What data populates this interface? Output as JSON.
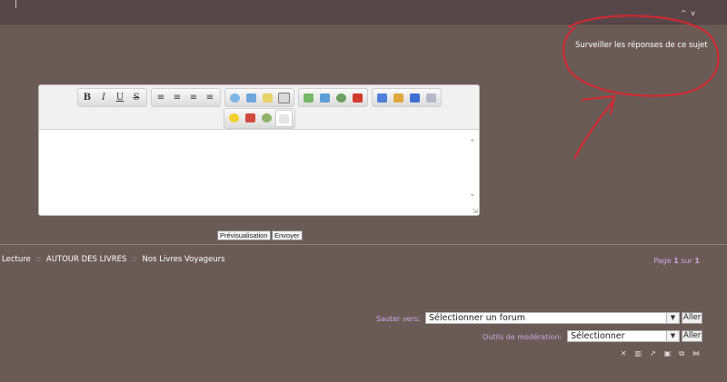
{
  "header": {
    "toggle": "^ v"
  },
  "watch_topic": "Surveiller les réponses de ce sujet",
  "colors": {
    "annotation": "#d8262e",
    "link_accent": "#c8a9e3",
    "background": "#6b5b56"
  },
  "toolbar": {
    "row1": [
      {
        "name": "bold-button",
        "label": "B"
      },
      {
        "name": "italic-button",
        "label": "I"
      },
      {
        "name": "underline-button",
        "label": "U"
      },
      {
        "name": "strikethrough-button",
        "label": "S"
      },
      {
        "name": "align-left-button",
        "label": "≡"
      },
      {
        "name": "align-center-button",
        "label": "≡"
      },
      {
        "name": "align-right-button",
        "label": "≡"
      },
      {
        "name": "justify-button",
        "label": "≡"
      }
    ],
    "icon_buttons": [
      "quote-icon",
      "code-icon",
      "spoiler-icon",
      "hide-icon",
      "image-icon",
      "host-icon",
      "link-icon",
      "youtube-icon",
      "font-color-icon",
      "font-size-icon",
      "font-family-icon",
      "clear-format-icon",
      "smiley-icon",
      "calendar-icon",
      "misc-icon",
      "source-mode-icon"
    ]
  },
  "buttons": {
    "preview": "Prévisualisation",
    "send": "Envoyer"
  },
  "breadcrumb": {
    "item1": "Lecture",
    "sep": "::",
    "item2": "AUTOUR DES LIVRES",
    "item3": "Nos Livres Voyageurs"
  },
  "pagination": {
    "label": "Page",
    "current": "1",
    "of": "sur",
    "total": "1"
  },
  "jump": {
    "label": "Sauter vers:",
    "selected": "Sélectionner un forum",
    "go": "Aller"
  },
  "moderation": {
    "label": "Outils de modération:",
    "selected": "Sélectionner",
    "go": "Aller"
  },
  "mod_icons": [
    "delete-icon",
    "trash-icon",
    "move-icon",
    "lock-icon",
    "split-icon",
    "merge-icon"
  ]
}
